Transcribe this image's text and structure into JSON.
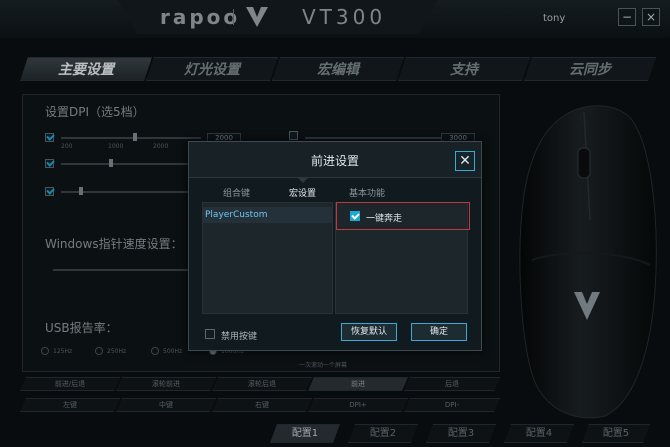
{
  "app": {
    "brand": "rapoo",
    "model": "VT300",
    "username": "tony",
    "minimize_label": "−",
    "close_label": "×"
  },
  "main_tabs": [
    {
      "label": "主要设置",
      "active": true
    },
    {
      "label": "灯光设置",
      "active": false
    },
    {
      "label": "宏编辑",
      "active": false
    },
    {
      "label": "支持",
      "active": false
    },
    {
      "label": "云同步",
      "active": false
    }
  ],
  "dpi_section": {
    "title": "设置DPI（选5档）",
    "scale_labels": [
      "200",
      "1000",
      "2000",
      "3000"
    ],
    "values": [
      "2000",
      "3000"
    ]
  },
  "windows_section": {
    "title": "Windows指针速度设置："
  },
  "usb_section": {
    "title": "USB报告率：",
    "options": [
      "125Hz",
      "250Hz",
      "500Hz",
      "1000Hz"
    ],
    "note": "一次滚动一个屏幕"
  },
  "bottom_grid": {
    "row1": [
      "前进/后退",
      "滚轮前进",
      "滚轮后退",
      "前进",
      "后退"
    ],
    "row2": [
      "左键",
      "中键",
      "右键",
      "DPI+",
      "DPI-"
    ]
  },
  "profiles": [
    "配置1",
    "配置2",
    "配置3",
    "配置4",
    "配置5"
  ],
  "dialog": {
    "title": "前进设置",
    "close_label": "✕",
    "tabs": [
      {
        "label": "组合键",
        "active": false
      },
      {
        "label": "宏设置",
        "active": true
      },
      {
        "label": "基本功能",
        "active": false
      }
    ],
    "macro_list": [
      "PlayerCustom"
    ],
    "function_item": "一键奔走",
    "function_checked": true,
    "disable_button_label": "禁用按键",
    "restore_default_label": "恢复默认",
    "ok_label": "确定"
  },
  "colors": {
    "accent": "#1aa8d6",
    "highlight_border": "#c0393f",
    "background": "#0a0f12"
  }
}
